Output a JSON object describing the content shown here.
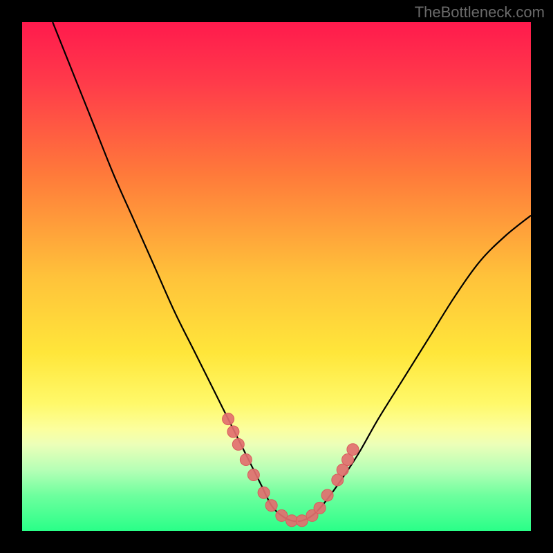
{
  "watermark": "TheBottleneck.com",
  "colors": {
    "frame": "#000000",
    "curve": "#000000",
    "marker_fill": "#e26f6f",
    "marker_stroke": "#d85c5c"
  },
  "chart_data": {
    "type": "line",
    "title": "",
    "xlabel": "",
    "ylabel": "",
    "xlim": [
      0,
      100
    ],
    "ylim": [
      0,
      100
    ],
    "gradient_stops": [
      {
        "offset": 0,
        "color": "#ff1a4d"
      },
      {
        "offset": 12,
        "color": "#ff3b4a"
      },
      {
        "offset": 30,
        "color": "#ff7a3a"
      },
      {
        "offset": 50,
        "color": "#ffc23a"
      },
      {
        "offset": 65,
        "color": "#ffe63a"
      },
      {
        "offset": 75,
        "color": "#fff96a"
      },
      {
        "offset": 80,
        "color": "#fcff9e"
      },
      {
        "offset": 83,
        "color": "#ecffb8"
      },
      {
        "offset": 88,
        "color": "#b6ffb6"
      },
      {
        "offset": 93,
        "color": "#6eff9e"
      },
      {
        "offset": 100,
        "color": "#2aff88"
      }
    ],
    "series": [
      {
        "name": "bottleneck-curve",
        "x": [
          6,
          10,
          14,
          18,
          22,
          26,
          30,
          34,
          38,
          42,
          45,
          47,
          49,
          51,
          53,
          55,
          57,
          59,
          62,
          66,
          70,
          75,
          80,
          85,
          90,
          95,
          100
        ],
        "y": [
          100,
          90,
          80,
          70,
          61,
          52,
          43,
          35,
          27,
          19,
          13,
          9,
          5,
          3,
          2,
          2,
          3,
          5,
          9,
          15,
          22,
          30,
          38,
          46,
          53,
          58,
          62
        ]
      }
    ],
    "markers": {
      "name": "highlight-dots",
      "x": [
        40.5,
        41.5,
        42.5,
        44,
        45.5,
        47.5,
        49,
        51,
        53,
        55,
        57,
        58.5,
        60,
        62,
        63,
        64,
        65
      ],
      "y": [
        22,
        19.5,
        17,
        14,
        11,
        7.5,
        5,
        3,
        2,
        2,
        3,
        4.5,
        7,
        10,
        12,
        14,
        16
      ]
    }
  }
}
